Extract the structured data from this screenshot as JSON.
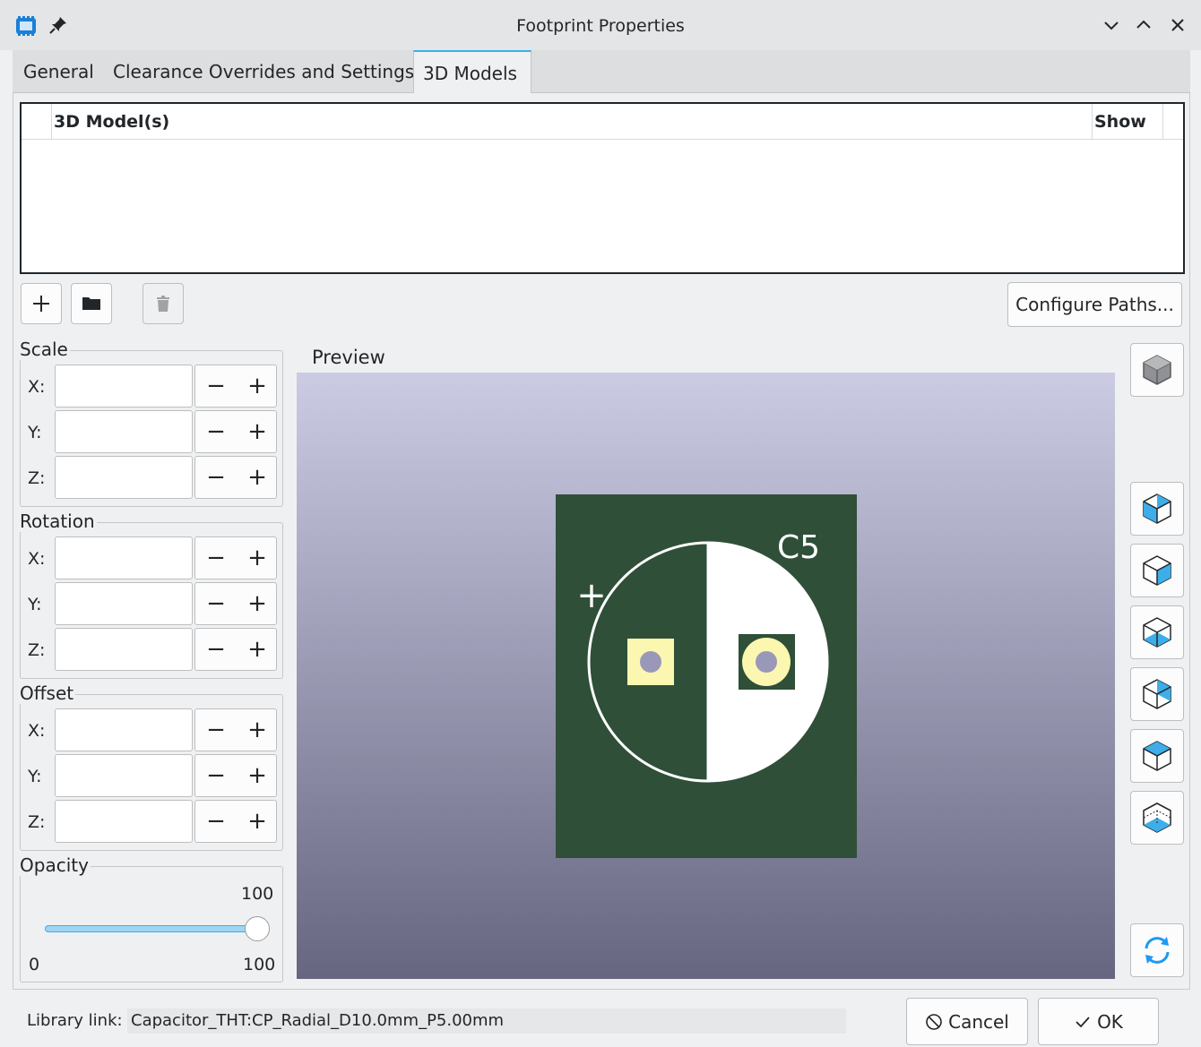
{
  "window": {
    "title": "Footprint Properties"
  },
  "tabs": [
    {
      "label": "General",
      "active": false
    },
    {
      "label": "Clearance Overrides and Settings",
      "active": false
    },
    {
      "label": "3D Models",
      "active": true
    }
  ],
  "models_table": {
    "columns": [
      "3D Model(s)",
      "Show"
    ],
    "rows": []
  },
  "toolbar": {
    "add_icon": "plus-icon",
    "browse_icon": "folder-icon",
    "delete_icon": "trash-icon",
    "configure_paths_label": "Configure Paths..."
  },
  "scale": {
    "label": "Scale",
    "x_label": "X:",
    "y_label": "Y:",
    "z_label": "Z:",
    "x": "",
    "y": "",
    "z": ""
  },
  "rotation": {
    "label": "Rotation",
    "x_label": "X:",
    "y_label": "Y:",
    "z_label": "Z:",
    "x": "",
    "y": "",
    "z": ""
  },
  "offset": {
    "label": "Offset",
    "x_label": "X:",
    "y_label": "Y:",
    "z_label": "Z:",
    "x": "",
    "y": "",
    "z": ""
  },
  "spin": {
    "minus": "−",
    "plus": "+"
  },
  "opacity": {
    "label": "Opacity",
    "value": "100",
    "min": "0",
    "max": "100",
    "level": 1.0
  },
  "preview": {
    "label": "Preview",
    "reference": "C5",
    "polarity_mark": "+",
    "board_color": "#2f4f38",
    "pad_color": "#fbf7b0",
    "background_top": "#cbcbe4",
    "background_bottom": "#666680"
  },
  "view_buttons": [
    "3d-cube-icon",
    "view-left-icon",
    "view-right-icon",
    "view-front-icon",
    "view-back-icon",
    "view-top-icon",
    "view-bottom-icon",
    "reload-icon"
  ],
  "footer": {
    "library_link_label": "Library link:",
    "library_link_value": "Capacitor_THT:CP_Radial_D10.0mm_P5.00mm",
    "cancel_label": "Cancel",
    "ok_label": "OK"
  },
  "colors": {
    "accent": "#3daee9",
    "window_bg": "#eff0f1"
  }
}
